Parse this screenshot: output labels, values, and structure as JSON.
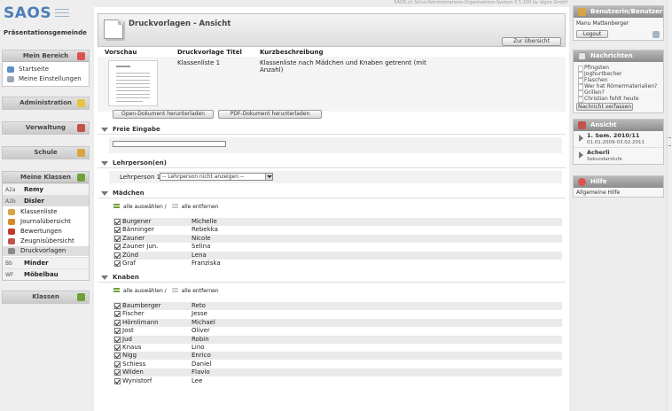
{
  "topbar": {
    "version": "SAOS.ch Schul-Administrations-Organisations-System 0.5.100 by digiro GmbH"
  },
  "brand": {
    "logo": "SAOS",
    "org": "Präsentationsgemeinde"
  },
  "sidebar": {
    "mein_bereich": {
      "title": "Mein Bereich",
      "items": [
        "Startseite",
        "Meine Einstellungen"
      ]
    },
    "administration": {
      "title": "Administration"
    },
    "verwaltung": {
      "title": "Verwaltung"
    },
    "schule": {
      "title": "Schule"
    },
    "meine_klassen": {
      "title": "Meine Klassen",
      "classes": [
        {
          "code": "A2a",
          "name": "Remy"
        },
        {
          "code": "A2b",
          "name": "Disler"
        }
      ],
      "sub": [
        "Klassenliste",
        "Journalübersicht",
        "Bewertungen",
        "Zeugnisübersicht",
        "Druckvorlagen"
      ],
      "classes2": [
        {
          "code": "Bb",
          "name": "Minder"
        },
        {
          "code": "WF",
          "name": "Möbelbau"
        }
      ]
    },
    "klassen": {
      "title": "Klassen"
    }
  },
  "main": {
    "title": "Druckvorlagen - Ansicht",
    "overview_button": "Zur Übersicht",
    "columns": [
      "Vorschau",
      "Druckvorlage Titel",
      "Kurzbeschreibung"
    ],
    "template": {
      "title": "Klassenliste 1",
      "description": "Klassenliste nach Mädchen und Knaben getrennt (mit Anzahl)"
    },
    "download_odt": "Open-Dokument herunterladen",
    "download_pdf": "PDF-Dokument herunterladen",
    "free_input": {
      "title": "Freie Eingabe",
      "value": ""
    },
    "teacher": {
      "title": "Lehrperson(en)",
      "label": "Lehrperson 1:",
      "selected": "-- Lehrperson nicht anzeigen --"
    },
    "select_all": "alle auswählen /",
    "remove_all": "alle entfernen",
    "girls": {
      "title": "Mädchen",
      "rows": [
        {
          "last": "Burgener",
          "first": "Michelle"
        },
        {
          "last": "Bänninger",
          "first": "Rebekka"
        },
        {
          "last": "Zauner",
          "first": "Nicole"
        },
        {
          "last": "Zauner jun.",
          "first": "Selina"
        },
        {
          "last": "Zünd",
          "first": "Lena"
        },
        {
          "last": "Graf",
          "first": "Franziska"
        }
      ]
    },
    "boys": {
      "title": "Knaben",
      "rows": [
        {
          "last": "Baumberger",
          "first": "Reto"
        },
        {
          "last": "Fischer",
          "first": "Jesse"
        },
        {
          "last": "Hörnlimann",
          "first": "Michael"
        },
        {
          "last": "Jost",
          "first": "Oliver"
        },
        {
          "last": "Jud",
          "first": "Robin"
        },
        {
          "last": "Knaus",
          "first": "Lino"
        },
        {
          "last": "Nigg",
          "first": "Enrico"
        },
        {
          "last": "Schiess",
          "first": "Daniel"
        },
        {
          "last": "Wilden",
          "first": "Flavio"
        },
        {
          "last": "Wynistorf",
          "first": "Lee"
        }
      ]
    }
  },
  "right": {
    "user": {
      "title": "Benutzerin/Benutzer",
      "name": "Manu Mattenberger",
      "logout": "Logout"
    },
    "news": {
      "title": "Nachrichten",
      "items": [
        "Pfingsten",
        "Joghurtbecher",
        "Flaschen",
        "Wer hat Römermaterialien?",
        "Grillen?",
        "Christian fehlt heute"
      ],
      "compose": "Nachricht verfassen"
    },
    "view": {
      "title": "Ansicht",
      "semester": "1. Sem. 2010/11",
      "dates": "01.01.2009-03.02.2011",
      "school": "Acherli",
      "level": "Sekundarstufe"
    },
    "help": {
      "title": "Hilfe",
      "item": "Allgemeine Hilfe"
    }
  },
  "colors": {
    "brand_blue": "#4d7fb8",
    "check_green": "#6ea13a"
  }
}
